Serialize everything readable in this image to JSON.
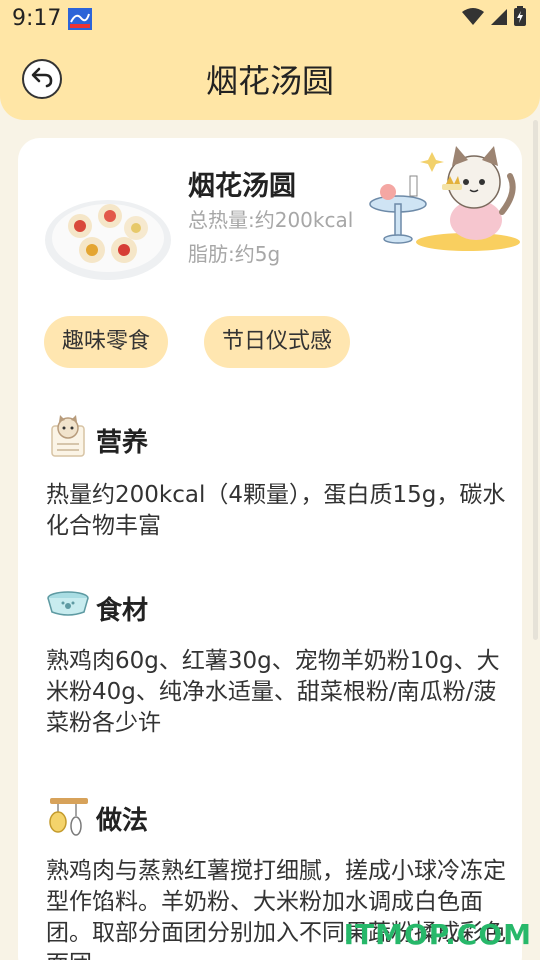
{
  "status_bar": {
    "time": "9:17"
  },
  "header": {
    "title": "烟花汤圆"
  },
  "recipe": {
    "name": "烟花汤圆",
    "calories": "总热量:约200kcal",
    "fat": "脂肪:约5g"
  },
  "tags": [
    "趣味零食",
    "节日仪式感"
  ],
  "sections": {
    "nutrition": {
      "title": "营养",
      "body": "热量约200kcal（4颗量），蛋白质15g，碳水化合物丰富"
    },
    "ingredients": {
      "title": "食材",
      "body": "熟鸡肉60g、红薯30g、宠物羊奶粉10g、大米粉40g、纯净水适量、甜菜根粉/南瓜粉/菠菜粉各少许"
    },
    "method": {
      "title": "做法",
      "body": "熟鸡肉与蒸熟红薯搅打细腻，搓成小球冷冻定型作馅料。羊奶粉、大米粉加水调成白色面团。取部分面团分别加入不同果蔬粉揉成彩色面团"
    }
  },
  "watermark": "ITMOP.COM",
  "colors": {
    "header_bg": "#ffe6a6",
    "tag_bg": "#ffe6b0",
    "page_bg": "#f8f3e6",
    "watermark": "#27b86a"
  },
  "icons": {
    "back": "back-arrow-icon",
    "nutrition": "cat-board-icon",
    "ingredients": "pet-bowl-icon",
    "method": "whisk-icon"
  }
}
